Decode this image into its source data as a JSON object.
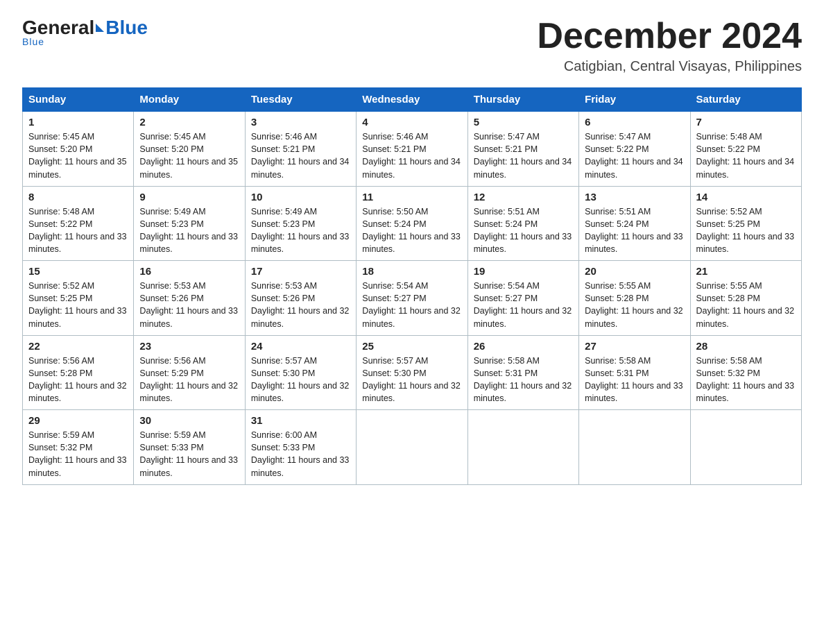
{
  "header": {
    "logo_general": "General",
    "logo_blue": "Blue",
    "month_title": "December 2024",
    "location": "Catigbian, Central Visayas, Philippines"
  },
  "weekdays": [
    "Sunday",
    "Monday",
    "Tuesday",
    "Wednesday",
    "Thursday",
    "Friday",
    "Saturday"
  ],
  "weeks": [
    [
      {
        "day": "1",
        "sunrise": "5:45 AM",
        "sunset": "5:20 PM",
        "daylight": "11 hours and 35 minutes."
      },
      {
        "day": "2",
        "sunrise": "5:45 AM",
        "sunset": "5:20 PM",
        "daylight": "11 hours and 35 minutes."
      },
      {
        "day": "3",
        "sunrise": "5:46 AM",
        "sunset": "5:21 PM",
        "daylight": "11 hours and 34 minutes."
      },
      {
        "day": "4",
        "sunrise": "5:46 AM",
        "sunset": "5:21 PM",
        "daylight": "11 hours and 34 minutes."
      },
      {
        "day": "5",
        "sunrise": "5:47 AM",
        "sunset": "5:21 PM",
        "daylight": "11 hours and 34 minutes."
      },
      {
        "day": "6",
        "sunrise": "5:47 AM",
        "sunset": "5:22 PM",
        "daylight": "11 hours and 34 minutes."
      },
      {
        "day": "7",
        "sunrise": "5:48 AM",
        "sunset": "5:22 PM",
        "daylight": "11 hours and 34 minutes."
      }
    ],
    [
      {
        "day": "8",
        "sunrise": "5:48 AM",
        "sunset": "5:22 PM",
        "daylight": "11 hours and 33 minutes."
      },
      {
        "day": "9",
        "sunrise": "5:49 AM",
        "sunset": "5:23 PM",
        "daylight": "11 hours and 33 minutes."
      },
      {
        "day": "10",
        "sunrise": "5:49 AM",
        "sunset": "5:23 PM",
        "daylight": "11 hours and 33 minutes."
      },
      {
        "day": "11",
        "sunrise": "5:50 AM",
        "sunset": "5:24 PM",
        "daylight": "11 hours and 33 minutes."
      },
      {
        "day": "12",
        "sunrise": "5:51 AM",
        "sunset": "5:24 PM",
        "daylight": "11 hours and 33 minutes."
      },
      {
        "day": "13",
        "sunrise": "5:51 AM",
        "sunset": "5:24 PM",
        "daylight": "11 hours and 33 minutes."
      },
      {
        "day": "14",
        "sunrise": "5:52 AM",
        "sunset": "5:25 PM",
        "daylight": "11 hours and 33 minutes."
      }
    ],
    [
      {
        "day": "15",
        "sunrise": "5:52 AM",
        "sunset": "5:25 PM",
        "daylight": "11 hours and 33 minutes."
      },
      {
        "day": "16",
        "sunrise": "5:53 AM",
        "sunset": "5:26 PM",
        "daylight": "11 hours and 33 minutes."
      },
      {
        "day": "17",
        "sunrise": "5:53 AM",
        "sunset": "5:26 PM",
        "daylight": "11 hours and 32 minutes."
      },
      {
        "day": "18",
        "sunrise": "5:54 AM",
        "sunset": "5:27 PM",
        "daylight": "11 hours and 32 minutes."
      },
      {
        "day": "19",
        "sunrise": "5:54 AM",
        "sunset": "5:27 PM",
        "daylight": "11 hours and 32 minutes."
      },
      {
        "day": "20",
        "sunrise": "5:55 AM",
        "sunset": "5:28 PM",
        "daylight": "11 hours and 32 minutes."
      },
      {
        "day": "21",
        "sunrise": "5:55 AM",
        "sunset": "5:28 PM",
        "daylight": "11 hours and 32 minutes."
      }
    ],
    [
      {
        "day": "22",
        "sunrise": "5:56 AM",
        "sunset": "5:28 PM",
        "daylight": "11 hours and 32 minutes."
      },
      {
        "day": "23",
        "sunrise": "5:56 AM",
        "sunset": "5:29 PM",
        "daylight": "11 hours and 32 minutes."
      },
      {
        "day": "24",
        "sunrise": "5:57 AM",
        "sunset": "5:30 PM",
        "daylight": "11 hours and 32 minutes."
      },
      {
        "day": "25",
        "sunrise": "5:57 AM",
        "sunset": "5:30 PM",
        "daylight": "11 hours and 32 minutes."
      },
      {
        "day": "26",
        "sunrise": "5:58 AM",
        "sunset": "5:31 PM",
        "daylight": "11 hours and 32 minutes."
      },
      {
        "day": "27",
        "sunrise": "5:58 AM",
        "sunset": "5:31 PM",
        "daylight": "11 hours and 33 minutes."
      },
      {
        "day": "28",
        "sunrise": "5:58 AM",
        "sunset": "5:32 PM",
        "daylight": "11 hours and 33 minutes."
      }
    ],
    [
      {
        "day": "29",
        "sunrise": "5:59 AM",
        "sunset": "5:32 PM",
        "daylight": "11 hours and 33 minutes."
      },
      {
        "day": "30",
        "sunrise": "5:59 AM",
        "sunset": "5:33 PM",
        "daylight": "11 hours and 33 minutes."
      },
      {
        "day": "31",
        "sunrise": "6:00 AM",
        "sunset": "5:33 PM",
        "daylight": "11 hours and 33 minutes."
      },
      {
        "day": "",
        "sunrise": "",
        "sunset": "",
        "daylight": ""
      },
      {
        "day": "",
        "sunrise": "",
        "sunset": "",
        "daylight": ""
      },
      {
        "day": "",
        "sunrise": "",
        "sunset": "",
        "daylight": ""
      },
      {
        "day": "",
        "sunrise": "",
        "sunset": "",
        "daylight": ""
      }
    ]
  ]
}
